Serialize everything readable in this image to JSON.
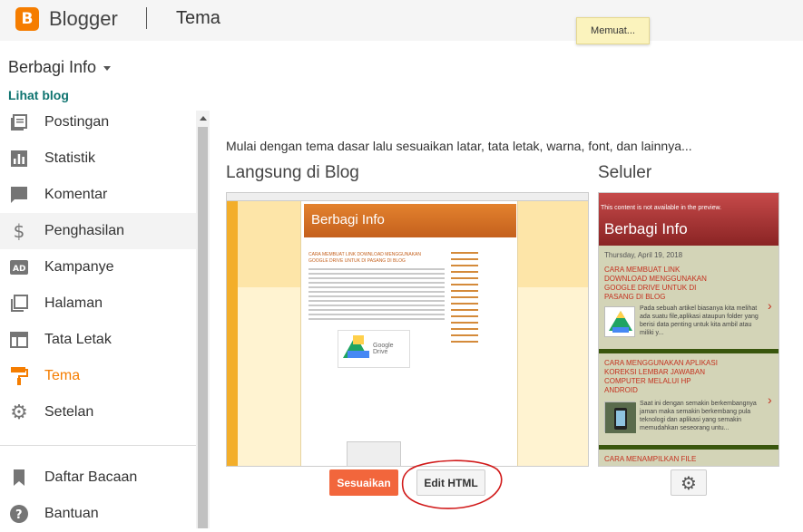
{
  "app": {
    "brand": "Blogger",
    "logo_letter": "B",
    "page": "Tema"
  },
  "toast": "Memuat...",
  "blog": {
    "name": "Berbagi Info",
    "view_link": "Lihat blog"
  },
  "nav": {
    "items": [
      {
        "label": "Postingan",
        "icon": "posts-icon"
      },
      {
        "label": "Statistik",
        "icon": "stats-icon"
      },
      {
        "label": "Komentar",
        "icon": "comment-icon"
      },
      {
        "label": "Penghasilan",
        "icon": "dollar-icon"
      },
      {
        "label": "Kampanye",
        "icon": "ad-icon"
      },
      {
        "label": "Halaman",
        "icon": "pages-icon"
      },
      {
        "label": "Tata Letak",
        "icon": "layout-icon"
      },
      {
        "label": "Tema",
        "icon": "paint-roller-icon"
      },
      {
        "label": "Setelan",
        "icon": "gear-icon"
      }
    ],
    "secondary": [
      {
        "label": "Daftar Bacaan",
        "icon": "bookmark-icon"
      },
      {
        "label": "Bantuan",
        "icon": "help-icon"
      }
    ],
    "active": "Tema",
    "accent": "#f57d00"
  },
  "main": {
    "intro": "Mulai dengan tema dasar lalu sesuaikan latar, tata letak, warna, font, dan lainnya...",
    "live_heading": "Langsung di Blog",
    "mobile_heading": "Seluler",
    "customize_label": "Sesuaikan",
    "edit_html_label": "Edit HTML"
  },
  "preview": {
    "blog_title": "Berbagi Info",
    "post_title": "CARA MEMBUAT LINK DOWNLOAD MENGGUNAKAN GOOGLE DRIVE UNTUK DI PASANG DI BLOG",
    "drive_label": "Google Drive"
  },
  "mobile_preview": {
    "note": "This content is not available in the preview.",
    "blog_title": "Berbagi Info",
    "date": "Thursday, April 19, 2018",
    "posts": [
      {
        "title": "CARA MEMBUAT LINK DOWNLOAD MENGGUNAKAN GOOGLE DRIVE UNTUK DI PASANG DI BLOG",
        "text": "Pada sebuah artikel biasanya kita melihat ada suatu file,aplikasi ataupun folder yang berisi data penting untuk kita ambil atau miliki y..."
      },
      {
        "title": "CARA MENGGUNAKAN APLIKASI KOREKSI LEMBAR JAWABAN COMPUTER MELALUI HP ANDROID",
        "text": "Saat ini dengan semakin berkembangnya jaman maka semakin berkembang pula teknologi dan aplikasi yang semakin memudahkan seseorang untu..."
      },
      {
        "title": "CARA MENAMPILKAN FILE",
        "text": ""
      }
    ]
  }
}
